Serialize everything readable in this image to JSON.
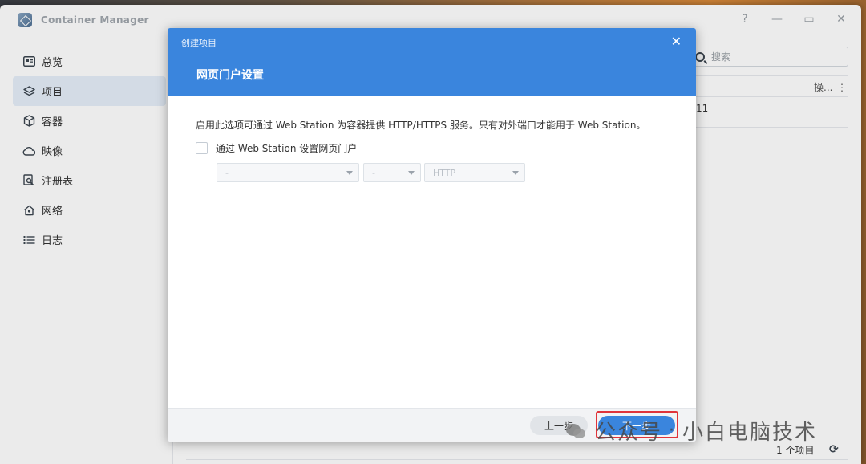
{
  "app": {
    "title": "Container Manager",
    "window_controls": [
      "?",
      "—",
      "▭",
      "✕"
    ]
  },
  "sidebar": {
    "items": [
      {
        "label": "总览",
        "icon": "dashboard-icon",
        "active": false
      },
      {
        "label": "项目",
        "icon": "layers-icon",
        "active": true
      },
      {
        "label": "容器",
        "icon": "box-icon",
        "active": false
      },
      {
        "label": "映像",
        "icon": "cloud-icon",
        "active": false
      },
      {
        "label": "注册表",
        "icon": "registry-search-icon",
        "active": false
      },
      {
        "label": "网络",
        "icon": "home-network-icon",
        "active": false
      },
      {
        "label": "日志",
        "icon": "list-icon",
        "active": false
      }
    ]
  },
  "main": {
    "search_placeholder": "搜索",
    "column_op": "操...",
    "column_more": "⋮",
    "row_time": ":11",
    "footer_count": "1 个项目",
    "refresh_icon": "⟳"
  },
  "dialog": {
    "caption": "创建项目",
    "close": "✕",
    "title": "网页门户设置",
    "description": "启用此选项可通过 Web Station 为容器提供 HTTP/HTTPS 服务。只有对外端口才能用于 Web Station。",
    "checkbox_label": "通过 Web Station 设置网页门户",
    "checkbox_checked": false,
    "select_host": "-",
    "select_port": "-",
    "select_protocol": "HTTP",
    "btn_prev": "上一步",
    "btn_next": "下一步"
  },
  "watermark": {
    "part1": "公众号",
    "sep": "·",
    "part2": "小白电脑技术"
  },
  "colors": {
    "accent": "#3a85dd",
    "highlight": "#e0343a",
    "active_nav_bg": "#e5eef9"
  }
}
